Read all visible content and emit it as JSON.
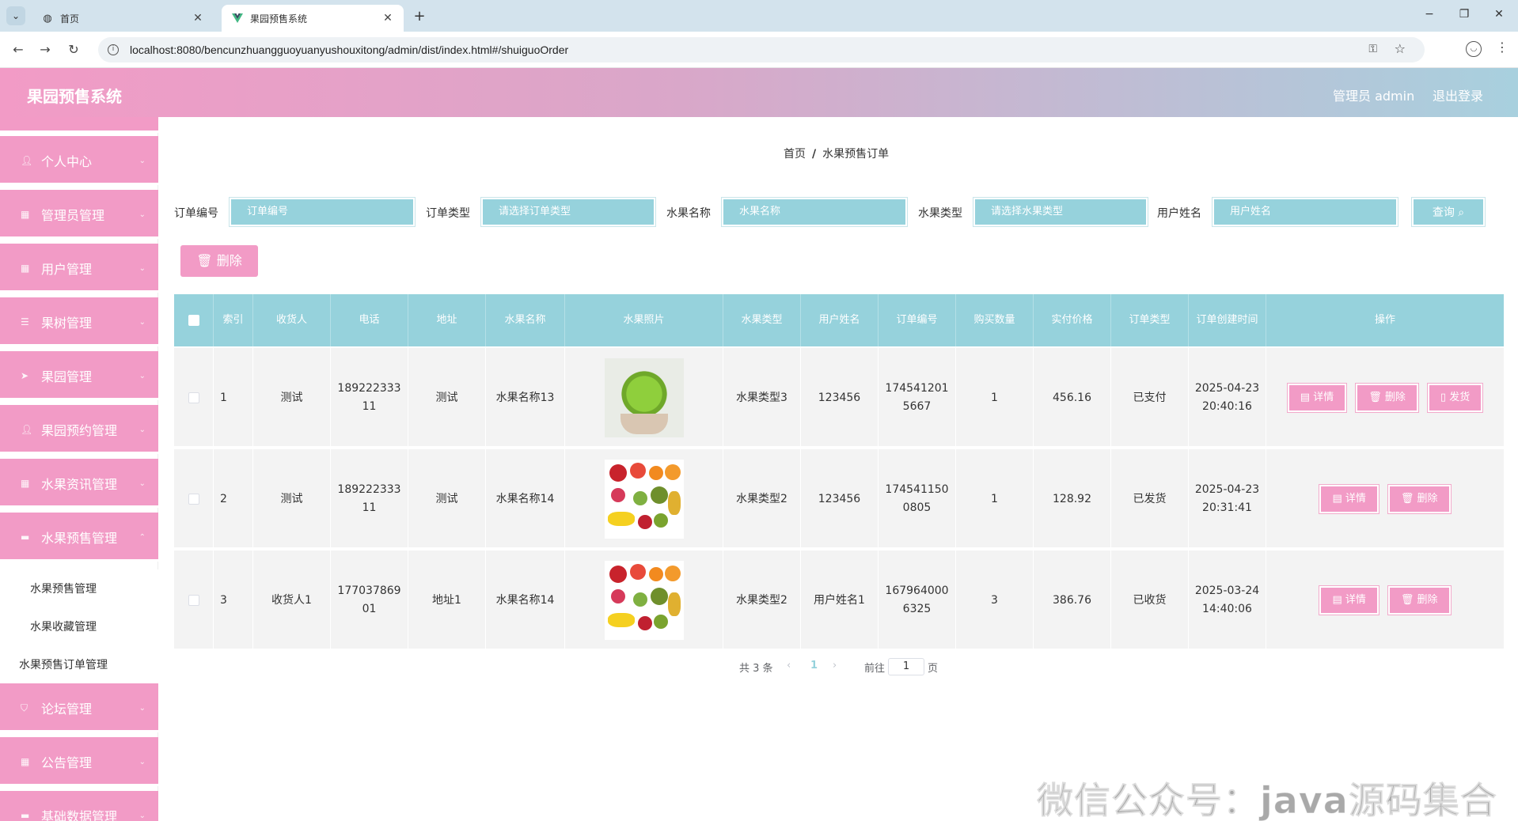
{
  "browser": {
    "tabs": [
      {
        "title": "首页",
        "icon": "globe-icon"
      },
      {
        "title": "果园预售系统",
        "icon": "vue-logo-icon"
      }
    ],
    "url": "localhost:8080/bencunzhuangguoyuanyushouxitong/admin/dist/index.html#/shuiguoOrder"
  },
  "header": {
    "title": "果园预售系统",
    "admin": "管理员 admin",
    "logout": "退出登录"
  },
  "sidebar": {
    "items": [
      {
        "label": "个人中心",
        "icon": "user-icon"
      },
      {
        "label": "管理员管理",
        "icon": "grid-icon"
      },
      {
        "label": "用户管理",
        "icon": "grid-icon"
      },
      {
        "label": "果树管理",
        "icon": "list-icon"
      },
      {
        "label": "果园管理",
        "icon": "send-icon"
      },
      {
        "label": "果园预约管理",
        "icon": "user-icon"
      },
      {
        "label": "水果资讯管理",
        "icon": "grid-icon"
      },
      {
        "label": "水果预售管理",
        "icon": "folder-icon"
      }
    ],
    "sub_items": [
      "水果预售管理",
      "水果收藏管理",
      "水果预售订单管理"
    ],
    "items_after": [
      {
        "label": "论坛管理",
        "icon": "shield-icon"
      },
      {
        "label": "公告管理",
        "icon": "grid-icon"
      },
      {
        "label": "基础数据管理",
        "icon": "folder-icon"
      }
    ]
  },
  "breadcrumb": {
    "home": "首页",
    "sep": "/",
    "current": "水果预售订单"
  },
  "search": {
    "labels": [
      "订单编号",
      "订单类型",
      "水果名称",
      "水果类型",
      "用户姓名"
    ],
    "placeholders": [
      "订单编号",
      "请选择订单类型",
      "水果名称",
      "请选择水果类型",
      "用户姓名"
    ],
    "query_button": "查询"
  },
  "toolbar": {
    "delete_label": "删除"
  },
  "table": {
    "headers": [
      "索引",
      "收货人",
      "电话",
      "地址",
      "水果名称",
      "水果照片",
      "水果类型",
      "用户姓名",
      "订单编号",
      "购买数量",
      "实付价格",
      "订单类型",
      "订单创建时间",
      "操作"
    ],
    "rows": [
      {
        "index": "1",
        "receiver": "测试",
        "phone": "18922233311",
        "address": "测试",
        "fruit_name": "水果名称13",
        "photo": "grapes",
        "fruit_type": "水果类型3",
        "user_name": "123456",
        "order_no": "1745412015667",
        "quantity": "1",
        "price": "456.16",
        "order_type": "已支付",
        "created": "2025-04-23 20:40:16",
        "actions": [
          "详情",
          "删除",
          "发货"
        ]
      },
      {
        "index": "2",
        "receiver": "测试",
        "phone": "18922233311",
        "address": "测试",
        "fruit_name": "水果名称14",
        "photo": "mixed",
        "fruit_type": "水果类型2",
        "user_name": "123456",
        "order_no": "1745411500805",
        "quantity": "1",
        "price": "128.92",
        "order_type": "已发货",
        "created": "2025-04-23 20:31:41",
        "actions": [
          "详情",
          "删除"
        ]
      },
      {
        "index": "3",
        "receiver": "收货人1",
        "phone": "17703786901",
        "address": "地址1",
        "fruit_name": "水果名称14",
        "photo": "mixed",
        "fruit_type": "水果类型2",
        "user_name": "用户姓名1",
        "order_no": "1679640006325",
        "quantity": "3",
        "price": "386.76",
        "order_type": "已收货",
        "created": "2025-03-24 14:40:06",
        "actions": [
          "详情",
          "删除"
        ]
      }
    ]
  },
  "pagination": {
    "total": "共 3 条",
    "current_page": "1",
    "goto_label": "前往",
    "goto_value": "1",
    "page_suffix": "页"
  },
  "watermark": "微信公众号：java源码集合"
}
